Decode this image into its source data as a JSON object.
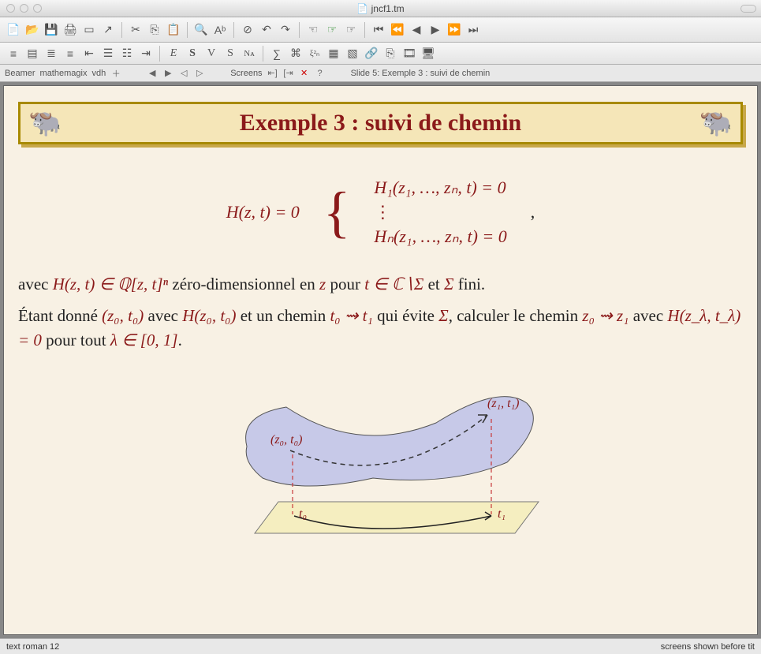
{
  "window": {
    "title": "jncf1.tm"
  },
  "context": {
    "crumbs": [
      "Beamer",
      "mathemagix",
      "vdh"
    ],
    "screens_label": "Screens",
    "slide_info": "Slide 5: Exemple 3 : suivi de chemin"
  },
  "slide": {
    "title": "Exemple 3 : suivi de chemin",
    "eq_left": "H(z, t) = 0",
    "eq_r1": "H₁(z₁, …, zₙ, t) = 0",
    "eq_r2": "⋮",
    "eq_r3": "Hₙ(z₁, …, zₙ, t) = 0",
    "eq_trail": ",",
    "para1_a": "avec ",
    "para1_m1": "H(z, t) ∈ ℚ[z, t]ⁿ",
    "para1_b": " zéro-dimensionnel en ",
    "para1_m2": "z",
    "para1_c": " pour ",
    "para1_m3": "t ∈ ℂ∖Σ",
    "para1_d": " et ",
    "para1_m4": "Σ",
    "para1_e": " fini.",
    "para2_a": "Étant donné ",
    "para2_m1": "(z₀, t₀)",
    "para2_b": " avec ",
    "para2_m2": "H(z₀, t₀)",
    "para2_c": " et un chemin ",
    "para2_m3": "t₀ ⇝ t₁",
    "para2_d": " qui évite ",
    "para2_m4": "Σ",
    "para2_e": ", calculer le chemin ",
    "para2_m5": "z₀ ⇝ z₁",
    "para2_f": " avec ",
    "para2_m6": "H(z_λ, t_λ) = 0",
    "para2_g": " pour tout ",
    "para2_m7": "λ ∈ [0, 1]",
    "para2_h": ".",
    "diag": {
      "z0t0": "(z₀, t₀)",
      "z1t1": "(z₁, t₁)",
      "t0": "t₀",
      "t1": "t₁"
    }
  },
  "status": {
    "left": "text roman 12",
    "right": "screens shown before tit"
  }
}
